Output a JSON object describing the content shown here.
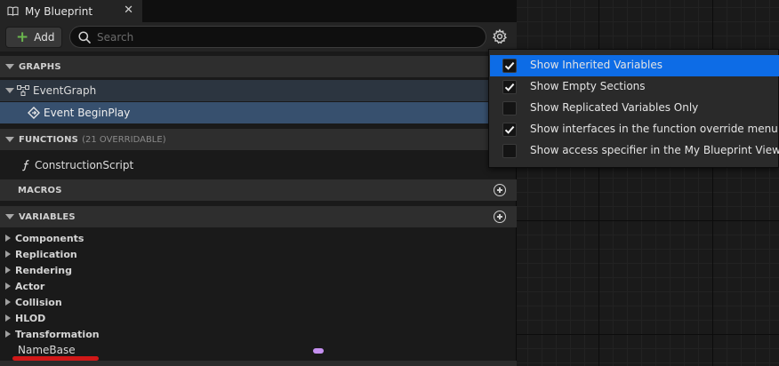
{
  "tab": {
    "title": "My Blueprint",
    "close": "✕"
  },
  "toolbar": {
    "add_label": "Add",
    "search_placeholder": "Search"
  },
  "sections": {
    "graphs": {
      "label": "GRAPHS"
    },
    "functions": {
      "label": "FUNCTIONS",
      "sub": "(21 OVERRIDABLE)"
    },
    "macros": {
      "label": "MACROS"
    },
    "variables": {
      "label": "VARIABLES"
    }
  },
  "graphs": {
    "event_graph": "EventGraph",
    "event_begin_play": "Event BeginPlay"
  },
  "functions": {
    "construction_script": "ConstructionScript"
  },
  "variable_categories": [
    "Components",
    "Replication",
    "Rendering",
    "Actor",
    "Collision",
    "HLOD",
    "Transformation"
  ],
  "variable": {
    "name": "NameBase",
    "type_color": "#c590f0"
  },
  "settings_menu": {
    "items": [
      {
        "label": "Show Inherited Variables",
        "checked": true,
        "highlighted": true
      },
      {
        "label": "Show Empty Sections",
        "checked": true,
        "highlighted": false
      },
      {
        "label": "Show Replicated Variables Only",
        "checked": false,
        "highlighted": false
      },
      {
        "label": "Show interfaces in the function override menu",
        "checked": true,
        "highlighted": false
      },
      {
        "label": "Show access specifier in the My Blueprint View",
        "checked": false,
        "highlighted": false
      }
    ]
  },
  "colors": {
    "selection": "#0d6ce6",
    "selected_row": "#37506e",
    "add_plus": "#6ab64e",
    "annotation_underline": "#d01818"
  }
}
